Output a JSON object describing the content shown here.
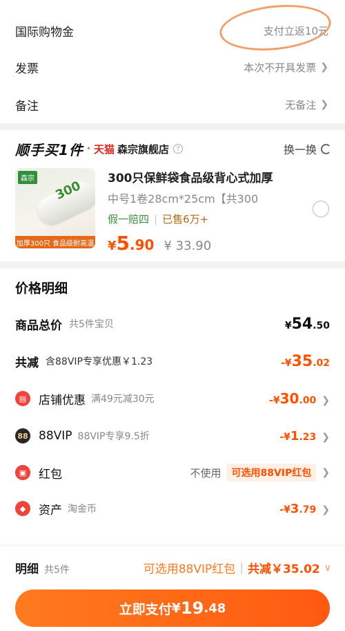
{
  "order": {
    "intl_credit": {
      "label": "国际购物金",
      "value": "支付立返10元"
    },
    "invoice": {
      "label": "发票",
      "value": "本次不开具发票"
    },
    "remark": {
      "label": "备注",
      "value": "无备注"
    }
  },
  "recommend": {
    "title": "顺手买1件",
    "platform": "天猫",
    "shop": "森宗旗舰店",
    "swap": "换一换",
    "product": {
      "brand_tag": "森宗",
      "image_label": "300",
      "image_banner": "加厚300只 食品级耐高温",
      "title": "300只保鲜袋食品级背心式加厚",
      "spec": "中号1卷28cm*25cm【共300",
      "tag_guarantee": "假一赔四",
      "sold": "已售6万+",
      "price_symbol": "¥",
      "price_int": "5",
      "price_dec": ".90",
      "original_price": "¥ 33.90"
    }
  },
  "details": {
    "title": "价格明细",
    "total": {
      "label": "商品总价",
      "sub": "共5件宝贝",
      "symbol": "¥",
      "int": "54",
      "dec": ".50"
    },
    "reduce": {
      "label": "共减",
      "sub": "含88VIP专享优惠￥1.23",
      "symbol": "-¥",
      "int": "35",
      "dec": ".02"
    },
    "shop_coupon": {
      "label": "店铺优惠",
      "sub": "满49元减30元",
      "symbol": "-¥",
      "int": "30",
      "dec": ".00"
    },
    "vip": {
      "icon_text": "88",
      "label": "88VIP",
      "sub": "88VIP专享9.5折",
      "symbol": "-¥",
      "int": "1",
      "dec": ".23"
    },
    "redpacket": {
      "label": "红包",
      "nouse": "不使用",
      "tag": "可选用88VIP红包"
    },
    "assets": {
      "label": "资产",
      "sub": "淘金币",
      "symbol": "-¥",
      "int": "3",
      "dec": ".79"
    }
  },
  "bottom": {
    "detail_label": "明细",
    "count": "共5件",
    "vip_redpacket": "可选用88VIP红包",
    "total_reduce": "共减￥35.02",
    "pay": {
      "label": "立即支付",
      "symbol": "¥",
      "int": "19",
      "dec": ".48"
    }
  },
  "colors": {
    "accent": "#ff5000",
    "button": "#ff6a16",
    "guarantee": "#3d8f3d",
    "tmall": "#e0281e"
  }
}
